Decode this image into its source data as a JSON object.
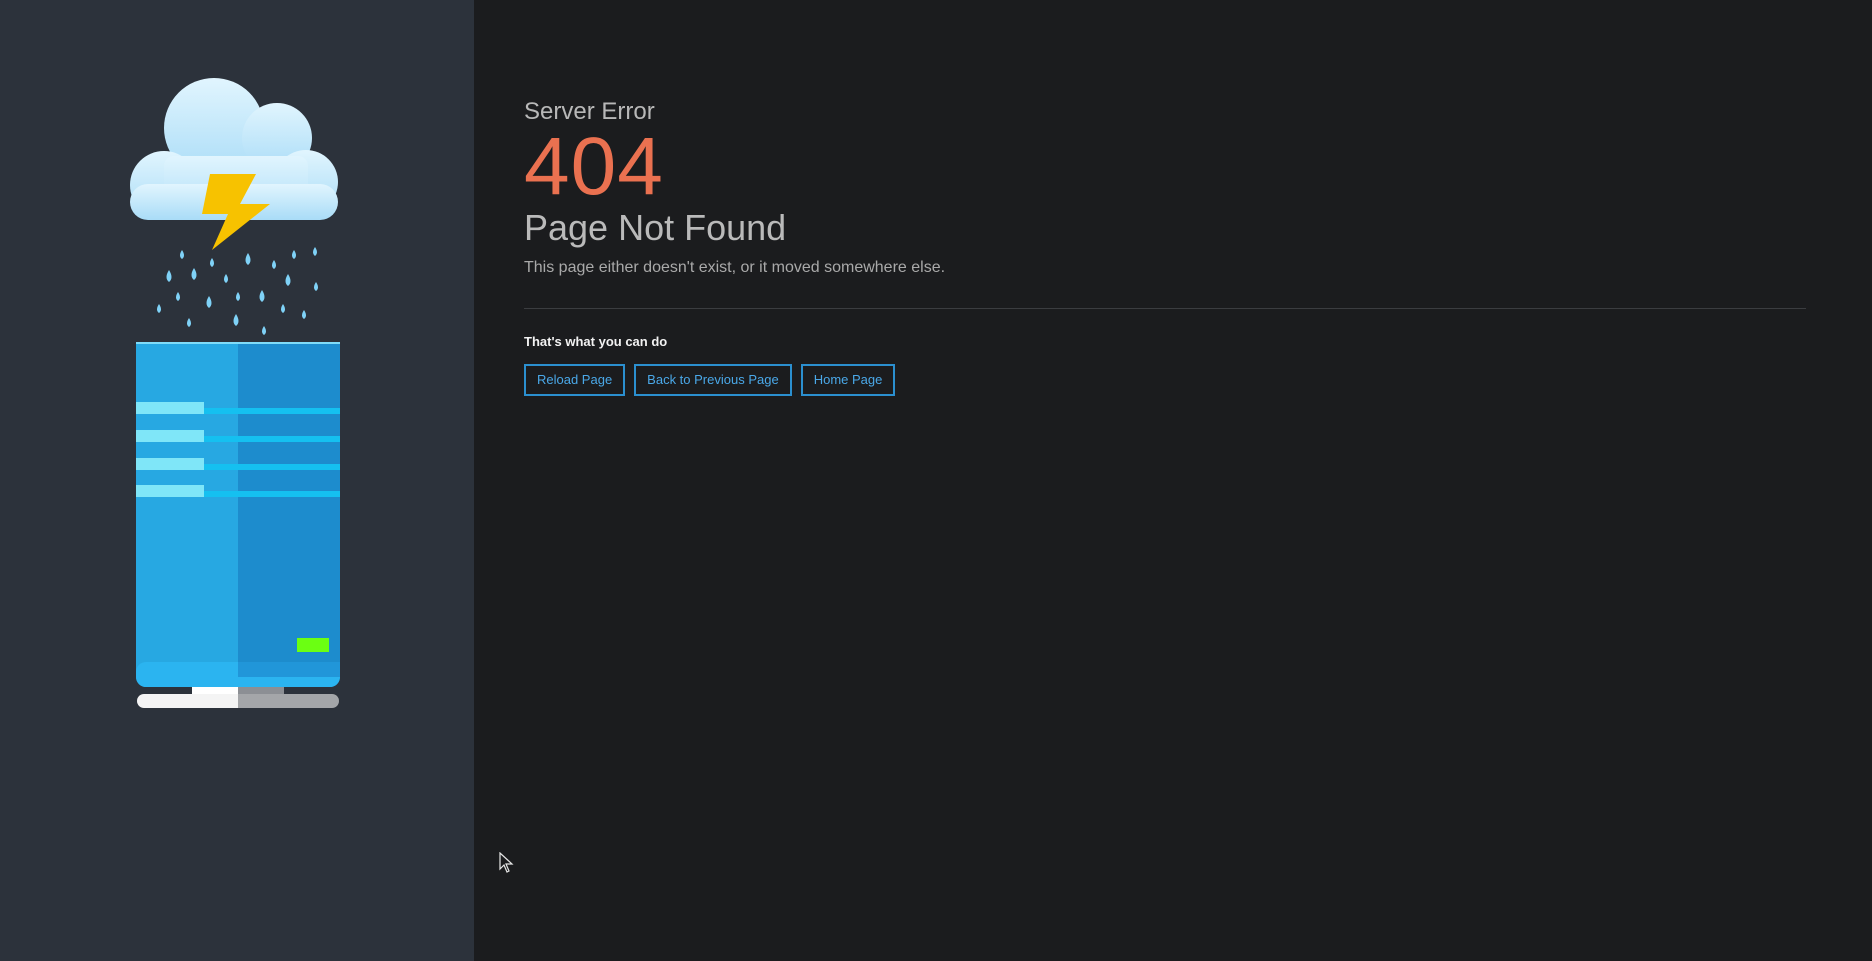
{
  "error": {
    "eyebrow": "Server Error",
    "code": "404",
    "title": "Page Not Found",
    "description": "This page either doesn't exist, or it moved somewhere else."
  },
  "actions": {
    "heading": "That's what you can do",
    "reload_label": "Reload Page",
    "back_label": "Back to Previous Page",
    "home_label": "Home Page"
  },
  "illustration": {
    "icon": "server-storm-icon"
  },
  "colors": {
    "left_panel_bg": "#2c323b",
    "right_panel_bg": "#1b1c1e",
    "code_accent": "#ea7150",
    "button_border": "#2b8fcf",
    "button_text": "#4aa8e8"
  }
}
